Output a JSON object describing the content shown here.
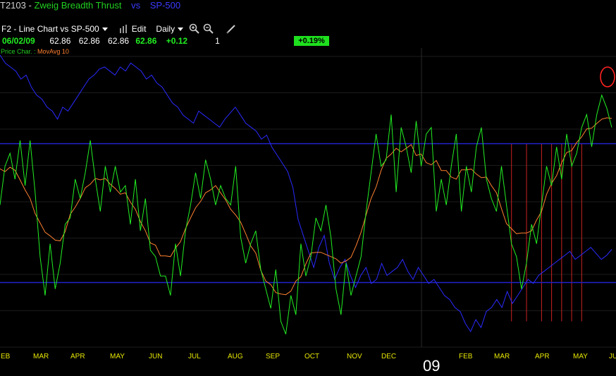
{
  "header": {
    "symbol": "T2103",
    "separator": "-",
    "title": "Zweig Breadth Thrust",
    "vs": "vs",
    "compare": "SP-500",
    "colors": {
      "title": "#21d021",
      "compare": "#3a3aff"
    }
  },
  "toolbar": {
    "chart_type": "F2 - Line Chart vs SP-500",
    "edit": "Edit",
    "period": "Daily",
    "icons": [
      "bar-chart-icon",
      "zoom-in-icon",
      "zoom-out-icon",
      "draw-pencil-icon"
    ]
  },
  "quote": {
    "date": "06/02/09",
    "open": "62.86",
    "high": "62.86",
    "low": "62.86",
    "close": "62.86",
    "change": "+0.12",
    "volume": "1",
    "pct_change": "+0.19%"
  },
  "legend": {
    "label": "Price Char. :",
    "indicator": "MovAvg 10"
  },
  "chart_data": {
    "type": "line",
    "x_tick_labels": [
      "EB",
      "MAR",
      "APR",
      "MAY",
      "JUN",
      "JUL",
      "AUG",
      "SEP",
      "OCT",
      "NOV",
      "DEC",
      "09",
      "FEB",
      "MAR",
      "APR",
      "MAY",
      "JU"
    ],
    "year_marker": "09",
    "y_range": [
      0.3,
      0.75
    ],
    "reference_lines": [
      0.615,
      0.4
    ],
    "series": [
      {
        "name": "Zweig Breadth Thrust",
        "color": "#22ee22",
        "y": [
          0.52,
          0.58,
          0.6,
          0.56,
          0.62,
          0.55,
          0.62,
          0.54,
          0.44,
          0.38,
          0.46,
          0.39,
          0.43,
          0.49,
          0.5,
          0.56,
          0.53,
          0.57,
          0.62,
          0.56,
          0.51,
          0.58,
          0.54,
          0.58,
          0.54,
          0.55,
          0.49,
          0.56,
          0.48,
          0.53,
          0.45,
          0.44,
          0.41,
          0.41,
          0.38,
          0.46,
          0.41,
          0.48,
          0.52,
          0.57,
          0.53,
          0.59,
          0.56,
          0.52,
          0.55,
          0.53,
          0.52,
          0.58,
          0.47,
          0.43,
          0.46,
          0.48,
          0.42,
          0.39,
          0.36,
          0.42,
          0.34,
          0.32,
          0.38,
          0.35,
          0.46,
          0.41,
          0.44,
          0.5,
          0.48,
          0.52,
          0.47,
          0.39,
          0.35,
          0.43,
          0.38,
          0.41,
          0.44,
          0.51,
          0.57,
          0.63,
          0.58,
          0.59,
          0.66,
          0.54,
          0.64,
          0.61,
          0.57,
          0.65,
          0.58,
          0.63,
          0.64,
          0.51,
          0.56,
          0.52,
          0.58,
          0.63,
          0.51,
          0.58,
          0.54,
          0.61,
          0.64,
          0.56,
          0.53,
          0.51,
          0.58,
          0.52,
          0.46,
          0.44,
          0.39,
          0.43,
          0.49,
          0.46,
          0.52,
          0.58,
          0.55,
          0.61,
          0.56,
          0.63,
          0.58,
          0.6,
          0.64,
          0.66,
          0.61,
          0.66,
          0.69,
          0.67,
          0.64
        ],
        "ma_color": "#ff8030"
      },
      {
        "name": "SP-500",
        "color": "#2a2aff",
        "y": [
          1430,
          1410,
          1400,
          1390,
          1370,
          1380,
          1350,
          1330,
          1320,
          1300,
          1290,
          1270,
          1300,
          1290,
          1310,
          1330,
          1350,
          1370,
          1380,
          1395,
          1400,
          1390,
          1380,
          1400,
          1390,
          1410,
          1400,
          1390,
          1370,
          1380,
          1360,
          1350,
          1330,
          1310,
          1300,
          1280,
          1270,
          1260,
          1290,
          1280,
          1270,
          1260,
          1250,
          1270,
          1285,
          1300,
          1280,
          1260,
          1250,
          1240,
          1220,
          1230,
          1200,
          1180,
          1160,
          1140,
          1100,
          1020,
          980,
          940,
          900,
          950,
          980,
          910,
          870,
          900,
          920,
          880,
          850,
          880,
          900,
          860,
          870,
          910,
          880,
          890,
          900,
          920,
          890,
          870,
          900,
          880,
          860,
          870,
          850,
          830,
          820,
          800,
          790,
          760,
          740,
          770,
          750,
          790,
          800,
          820,
          800,
          840,
          810,
          830,
          850,
          870,
          860,
          880,
          890,
          900,
          910,
          920,
          930,
          940,
          920,
          930,
          940,
          950,
          935,
          920,
          930,
          945
        ]
      }
    ],
    "signal_markers": [
      "MAR",
      "APR",
      "MAY"
    ]
  }
}
